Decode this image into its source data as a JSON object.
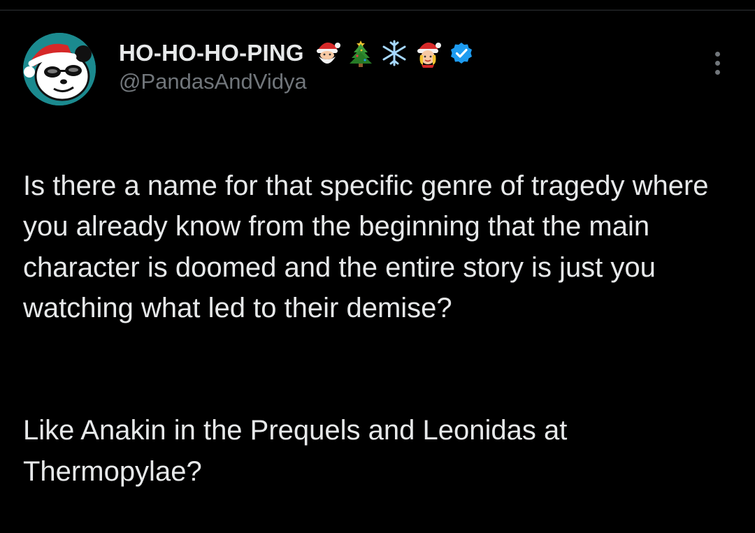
{
  "user": {
    "display_name": "HO-HO-HO-PING",
    "handle": "@PandasAndVidya",
    "name_emojis": [
      "santa-emoji",
      "christmas-tree-emoji",
      "snowflake-emoji",
      "mrs-claus-emoji"
    ],
    "verified": true
  },
  "tweet": {
    "paragraph_1": "Is there a name for that specific genre of tragedy where you already know from the beginning that the main character is doomed and the entire story is just you watching what led to their demise?",
    "paragraph_2": "Like Anakin in the Prequels and Leonidas at Thermopylae?"
  },
  "colors": {
    "background": "#000000",
    "text_primary": "#e7e9ea",
    "text_secondary": "#71767b",
    "verified_blue": "#1d9bf0",
    "avatar_bg": "#1b8a8f",
    "divider": "#2f3336"
  }
}
